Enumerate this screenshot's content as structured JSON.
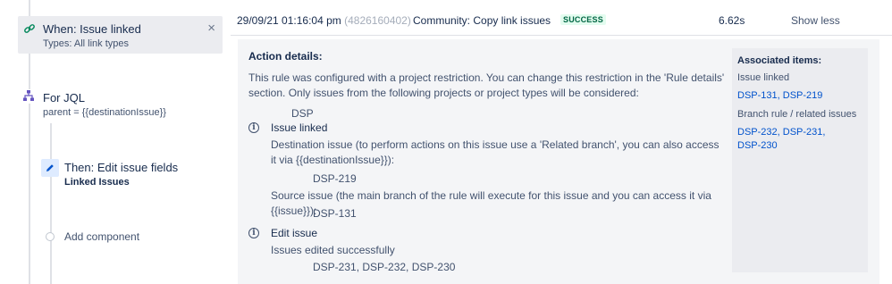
{
  "rule": {
    "trigger": {
      "title": "When: Issue linked",
      "subtitle": "Types: All link types",
      "icon": "link-icon",
      "close_symbol": "×"
    },
    "branch": {
      "title": "For JQL",
      "subtitle": "parent = {{destinationIssue}}",
      "icon": "branch-icon"
    },
    "action": {
      "title": "Then: Edit issue fields",
      "subtitle": "Linked Issues",
      "icon": "pencil-icon"
    },
    "add_component": "Add component"
  },
  "log": {
    "date": "29/09/21 01:16:04 pm",
    "id": "(4826160402)",
    "rule_name": "Community: Copy link issues",
    "status": "SUCCESS",
    "status_color": "#006644",
    "duration": "6.62s",
    "toggle": "Show less"
  },
  "details": {
    "heading": "Action details:",
    "restriction_text": "This rule was configured with a project restriction. You can change this restriction in the 'Rule details' section. Only issues from the following projects or project types will be considered:",
    "restriction_project": "DSP",
    "entries": [
      {
        "title": "Issue linked",
        "lines": [
          {
            "text": "Destination issue (to perform actions on this issue use a 'Related branch', you can also access it via {{destinationIssue}}):",
            "value": "DSP-219"
          },
          {
            "text": "Source issue (the main branch of the rule will execute for this issue and you can access it via {{issue}}):",
            "value": "DSP-131"
          }
        ]
      },
      {
        "title": "Edit issue",
        "lines": [
          {
            "text": "Issues edited successfully",
            "value": "DSP-231, DSP-232, DSP-230"
          }
        ]
      }
    ]
  },
  "associated": {
    "title": "Associated items:",
    "groups": [
      {
        "label": "Issue linked",
        "links": [
          "DSP-131",
          "DSP-219"
        ]
      },
      {
        "label": "Branch rule / related issues",
        "links": [
          "DSP-232",
          "DSP-231",
          "DSP-230"
        ]
      }
    ]
  }
}
